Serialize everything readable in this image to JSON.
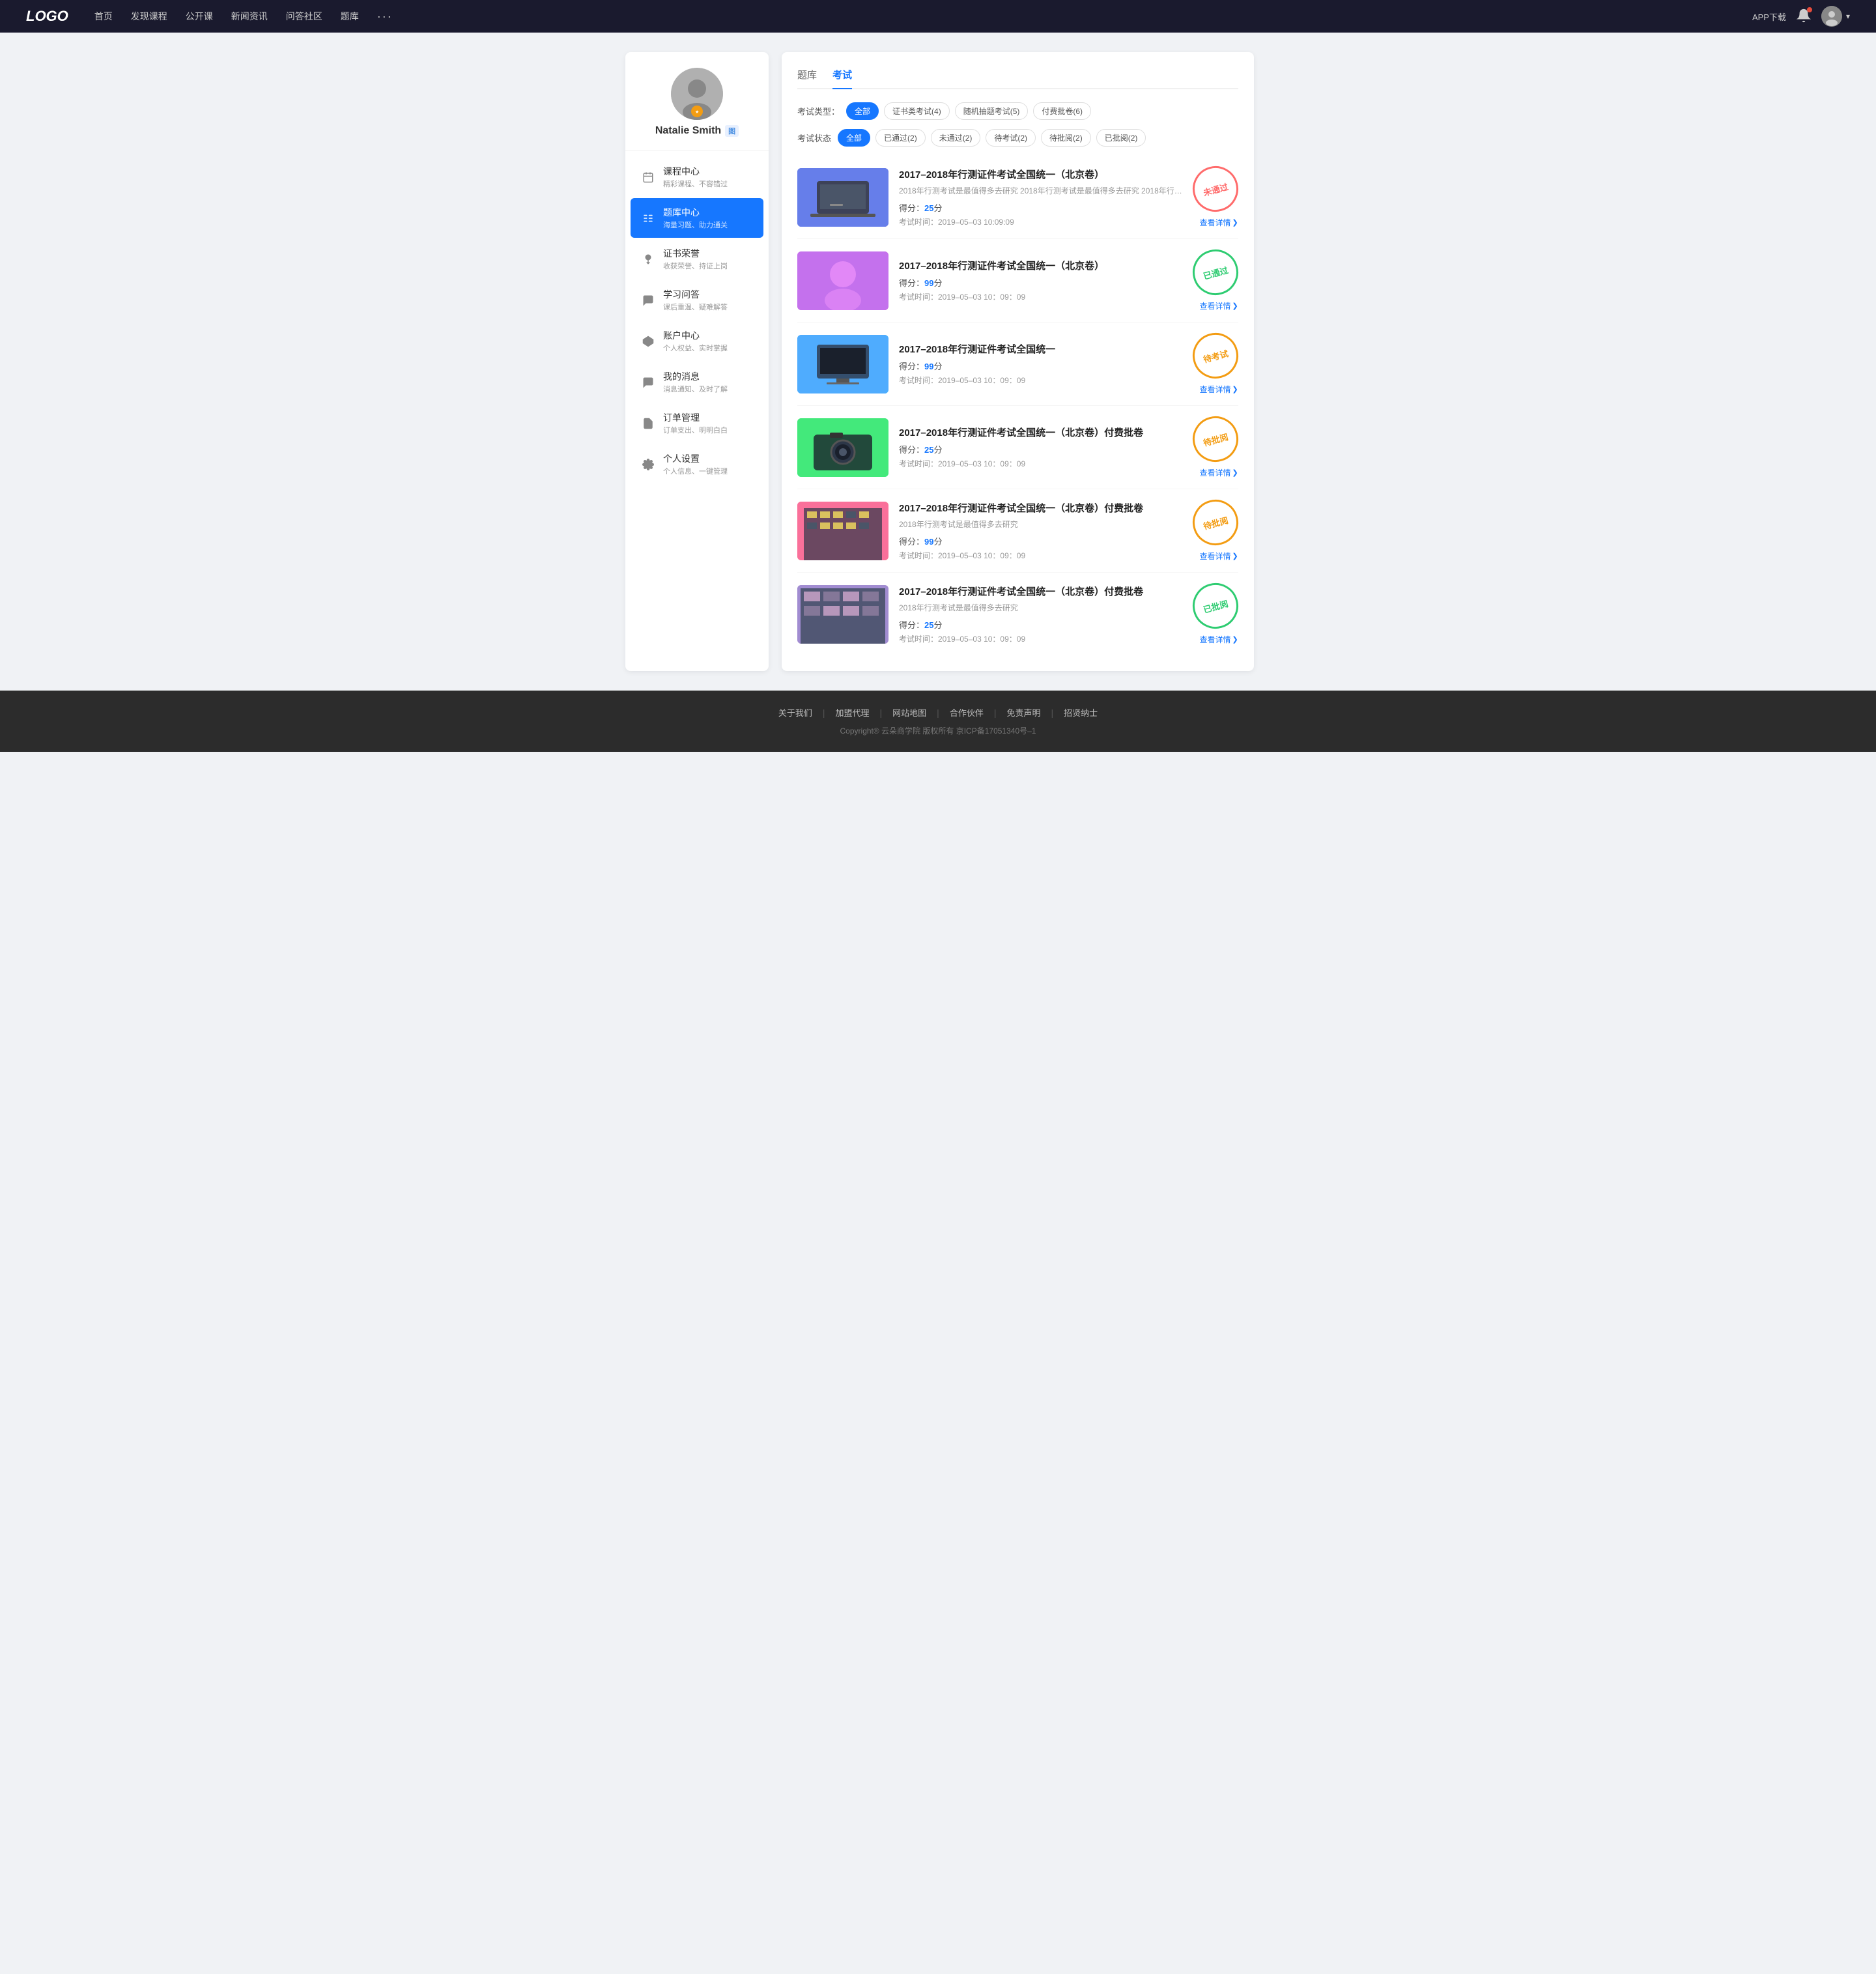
{
  "header": {
    "logo": "LOGO",
    "nav": [
      "首页",
      "发现课程",
      "公开课",
      "新闻资讯",
      "问答社区",
      "题库"
    ],
    "more": "···",
    "app_download": "APP下载",
    "user_name": "Natalie Smith"
  },
  "sidebar": {
    "profile": {
      "name": "Natalie Smith",
      "tag": "图"
    },
    "menu": [
      {
        "id": "course",
        "label": "课程中心",
        "sub": "精彩课程、不容错过",
        "icon": "calendar"
      },
      {
        "id": "question-bank",
        "label": "题库中心",
        "sub": "海量习题、助力通关",
        "icon": "list",
        "active": true
      },
      {
        "id": "certificate",
        "label": "证书荣誉",
        "sub": "收获荣誉、持证上岗",
        "icon": "award"
      },
      {
        "id": "qa",
        "label": "学习问答",
        "sub": "课后重温、疑难解答",
        "icon": "chat"
      },
      {
        "id": "account",
        "label": "账户中心",
        "sub": "个人权益、实时掌握",
        "icon": "diamond"
      },
      {
        "id": "messages",
        "label": "我的消息",
        "sub": "消息通知、及时了解",
        "icon": "message"
      },
      {
        "id": "orders",
        "label": "订单管理",
        "sub": "订单支出、明明白白",
        "icon": "doc"
      },
      {
        "id": "settings",
        "label": "个人设置",
        "sub": "个人信息、一键管理",
        "icon": "gear"
      }
    ]
  },
  "content": {
    "tabs": [
      "题库",
      "考试"
    ],
    "active_tab": "考试",
    "exam_type_label": "考试类型：",
    "exam_type_filters": [
      {
        "label": "全部",
        "active": true
      },
      {
        "label": "证书类考试(4)"
      },
      {
        "label": "随机抽题考试(5)"
      },
      {
        "label": "付费批卷(6)"
      }
    ],
    "exam_status_label": "考试状态",
    "exam_status_filters": [
      {
        "label": "全部",
        "active": true
      },
      {
        "label": "已通过(2)"
      },
      {
        "label": "未通过(2)"
      },
      {
        "label": "待考试(2)"
      },
      {
        "label": "待批阅(2)"
      },
      {
        "label": "已批阅(2)"
      }
    ],
    "exams": [
      {
        "title": "2017–2018年行测证件考试全国统一（北京卷）",
        "desc": "2018年行测考试是最值得多去研究 2018年行测考试是最值得多去研究 2018年行…",
        "score_label": "得分：",
        "score": "25",
        "score_suffix": "分",
        "time_label": "考试时间：",
        "time": "2019–05–03  10:09:09",
        "status": "未通过",
        "status_type": "fail",
        "view_label": "查看详情",
        "thumb_class": "thumb-1"
      },
      {
        "title": "2017–2018年行测证件考试全国统一（北京卷）",
        "desc": "",
        "score_label": "得分：",
        "score": "99",
        "score_suffix": "分",
        "time_label": "考试时间：",
        "time": "2019–05–03  10：09：09",
        "status": "已通过",
        "status_type": "pass",
        "view_label": "查看详情",
        "thumb_class": "thumb-2"
      },
      {
        "title": "2017–2018年行测证件考试全国统一",
        "desc": "",
        "score_label": "得分：",
        "score": "99",
        "score_suffix": "分",
        "time_label": "考试时间：",
        "time": "2019–05–03  10：09：09",
        "status": "待考试",
        "status_type": "pending",
        "view_label": "查看详情",
        "thumb_class": "thumb-3"
      },
      {
        "title": "2017–2018年行测证件考试全国统一（北京卷）付费批卷",
        "desc": "",
        "score_label": "得分：",
        "score": "25",
        "score_suffix": "分",
        "time_label": "考试时间：",
        "time": "2019–05–03  10：09：09",
        "status": "待批阅",
        "status_type": "reviewing",
        "view_label": "查看详情",
        "thumb_class": "thumb-4"
      },
      {
        "title": "2017–2018年行测证件考试全国统一（北京卷）付费批卷",
        "desc": "2018年行测考试是最值得多去研究",
        "score_label": "得分：",
        "score": "99",
        "score_suffix": "分",
        "time_label": "考试时间：",
        "time": "2019–05–03  10：09：09",
        "status": "待批阅",
        "status_type": "reviewing",
        "view_label": "查看详情",
        "thumb_class": "thumb-5"
      },
      {
        "title": "2017–2018年行测证件考试全国统一（北京卷）付费批卷",
        "desc": "2018年行测考试是最值得多去研究",
        "score_label": "得分：",
        "score": "25",
        "score_suffix": "分",
        "time_label": "考试时间：",
        "time": "2019–05–03  10：09：09",
        "status": "已批阅",
        "status_type": "reviewed",
        "view_label": "查看详情",
        "thumb_class": "thumb-6"
      }
    ]
  },
  "footer": {
    "links": [
      "关于我们",
      "加盟代理",
      "网站地图",
      "合作伙伴",
      "免责声明",
      "招贤纳士"
    ],
    "copyright": "Copyright® 云朵商学院  版权所有    京ICP备17051340号–1"
  }
}
